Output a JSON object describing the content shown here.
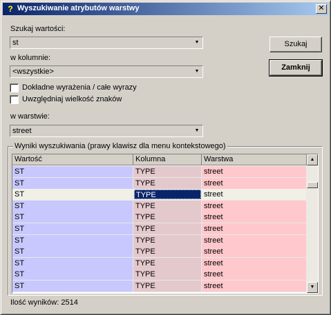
{
  "window": {
    "title": "Wyszukiwanie atrybutów warstwy",
    "close_glyph": "✕",
    "icon_glyph": "?"
  },
  "form": {
    "search_label": "Szukaj wartości:",
    "search_value": "st",
    "column_label": "w kolumnie:",
    "column_value": "<wszystkie>",
    "exact_label": "Dokładne wyrażenia / całe wyrazy",
    "exact_checked": false,
    "case_label": "Uwzględniaj wielkość znaków",
    "case_checked": false,
    "layer_label": "w warstwie:",
    "layer_value": "street",
    "dropdown_glyph": "▼"
  },
  "buttons": {
    "search": "Szukaj",
    "close": "Zamknij"
  },
  "results": {
    "group_title": "Wyniki wyszukiwania (prawy klawisz dla menu kontekstowego)",
    "columns": [
      "Wartość",
      "Kolumna",
      "Warstwa"
    ],
    "rows": [
      [
        "ST",
        "TYPE",
        "street"
      ],
      [
        "ST",
        "TYPE",
        "street"
      ],
      [
        "ST",
        "TYPE",
        "street"
      ],
      [
        "ST",
        "TYPE",
        "street"
      ],
      [
        "ST",
        "TYPE",
        "street"
      ],
      [
        "ST",
        "TYPE",
        "street"
      ],
      [
        "ST",
        "TYPE",
        "street"
      ],
      [
        "ST",
        "TYPE",
        "street"
      ],
      [
        "ST",
        "TYPE",
        "street"
      ],
      [
        "ST",
        "TYPE",
        "street"
      ],
      [
        "ST",
        "TYPE",
        "street"
      ]
    ],
    "selected_row": 2,
    "scroll_up_glyph": "▲",
    "scroll_down_glyph": "▼"
  },
  "status": {
    "count_text": "Ilość wyników: 2514"
  }
}
